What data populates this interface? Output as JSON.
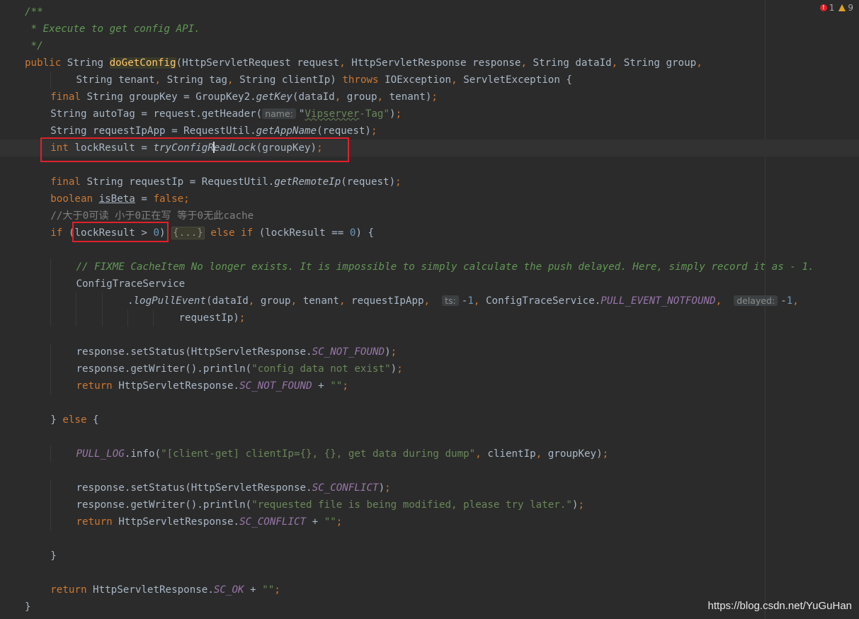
{
  "inspections": {
    "errors": "1",
    "warnings": "9",
    "error_color": "#e0202a",
    "warning_color": "#e0a321"
  },
  "watermark": "https://blog.csdn.net/YuGuHan",
  "colors": {
    "background": "#2b2b2b",
    "keyword": "#cc7832",
    "string": "#6a8759",
    "number": "#6897bb",
    "method_decl": "#ffc66d",
    "constant": "#9876aa",
    "comment": "#808080",
    "doc": "#629755",
    "highlight_box": "#e0202a"
  },
  "lines": [
    {
      "tokens": [
        {
          "t": "/**",
          "c": "doc"
        }
      ]
    },
    {
      "tokens": [
        {
          "t": " * Execute to get config API.",
          "c": "doc"
        }
      ]
    },
    {
      "tokens": [
        {
          "t": " */",
          "c": "doc"
        }
      ]
    },
    {
      "tokens": [
        {
          "t": "public ",
          "c": "kw"
        },
        {
          "t": "String "
        },
        {
          "t": "doGetConfig",
          "c": "fn"
        },
        {
          "t": "(HttpServletRequest request"
        },
        {
          "t": ", ",
          "c": "kw"
        },
        {
          "t": "HttpServletResponse response"
        },
        {
          "t": ", ",
          "c": "kw"
        },
        {
          "t": "String dataId"
        },
        {
          "t": ", ",
          "c": "kw"
        },
        {
          "t": "String group"
        },
        {
          "t": ",",
          "c": "kw"
        }
      ]
    },
    {
      "indent": 8,
      "tokens": [
        {
          "t": "String tenant"
        },
        {
          "t": ", ",
          "c": "kw"
        },
        {
          "t": "String tag"
        },
        {
          "t": ", ",
          "c": "kw"
        },
        {
          "t": "String clientIp) "
        },
        {
          "t": "throws ",
          "c": "kw"
        },
        {
          "t": "IOException"
        },
        {
          "t": ", ",
          "c": "kw"
        },
        {
          "t": "ServletException {"
        }
      ]
    },
    {
      "indent": 4,
      "tokens": [
        {
          "t": "final ",
          "c": "kw"
        },
        {
          "t": "String groupKey = GroupKey2."
        },
        {
          "t": "getKey",
          "c": "static"
        },
        {
          "t": "(dataId"
        },
        {
          "t": ", ",
          "c": "kw"
        },
        {
          "t": "group"
        },
        {
          "t": ", ",
          "c": "kw"
        },
        {
          "t": "tenant)"
        },
        {
          "t": ";",
          "c": "kw"
        }
      ]
    },
    {
      "indent": 4,
      "tokens": [
        {
          "t": "String autoTag = request.getHeader("
        },
        {
          "t": "name:",
          "c": "hint"
        },
        {
          "t": "\""
        },
        {
          "t": "Vipserver",
          "c": "squig"
        },
        {
          "t": "-Tag\"",
          "c": "str"
        },
        {
          "t": ")"
        },
        {
          "t": ";",
          "c": "kw"
        }
      ]
    },
    {
      "indent": 4,
      "tokens": [
        {
          "t": "String requestIpApp = RequestUtil."
        },
        {
          "t": "getAppName",
          "c": "static"
        },
        {
          "t": "(request)"
        },
        {
          "t": ";",
          "c": "kw"
        }
      ]
    },
    {
      "indent": 4,
      "current": true,
      "tokens": [
        {
          "t": "int ",
          "c": "kw"
        },
        {
          "t": "lockResult = "
        },
        {
          "t": "tryConfigR",
          "c": "static"
        },
        {
          "t": "",
          "c": "caret"
        },
        {
          "t": "eadLock",
          "c": "static"
        },
        {
          "t": "(groupKey)"
        },
        {
          "t": ";",
          "c": "kw"
        }
      ]
    },
    {
      "tokens": []
    },
    {
      "indent": 4,
      "tokens": [
        {
          "t": "final ",
          "c": "kw"
        },
        {
          "t": "String requestIp = RequestUtil."
        },
        {
          "t": "getRemoteIp",
          "c": "static"
        },
        {
          "t": "(request)"
        },
        {
          "t": ";",
          "c": "kw"
        }
      ]
    },
    {
      "indent": 4,
      "tokens": [
        {
          "t": "boolean ",
          "c": "kw"
        },
        {
          "t": "isBeta",
          "c": "under"
        },
        {
          "t": " = "
        },
        {
          "t": "false",
          "c": "kw"
        },
        {
          "t": ";",
          "c": "kw"
        }
      ]
    },
    {
      "indent": 4,
      "tokens": [
        {
          "t": "//大于0可读 小于0正在写 等于0无此cache",
          "c": "cmt"
        }
      ]
    },
    {
      "indent": 4,
      "tokens": [
        {
          "t": "if ",
          "c": "kw"
        },
        {
          "t": "(lockResult > "
        },
        {
          "t": "0",
          "c": "num"
        },
        {
          "t": ") "
        },
        {
          "t": "{...}",
          "c": "fold"
        },
        {
          "t": " else if ",
          "c": "kw"
        },
        {
          "t": "(lockResult == "
        },
        {
          "t": "0",
          "c": "num"
        },
        {
          "t": ") {"
        }
      ]
    },
    {
      "tokens": []
    },
    {
      "indent": 8,
      "tokens": [
        {
          "t": "// FIXME CacheItem No longer exists. It is impossible to simply calculate the push delayed. Here, simply record it as - 1.",
          "c": "todo"
        }
      ]
    },
    {
      "indent": 8,
      "tokens": [
        {
          "t": "ConfigTraceService"
        }
      ]
    },
    {
      "indent": 16,
      "tokens": [
        {
          "t": "."
        },
        {
          "t": "logPullEvent",
          "c": "static"
        },
        {
          "t": "(dataId"
        },
        {
          "t": ", ",
          "c": "kw"
        },
        {
          "t": "group"
        },
        {
          "t": ", ",
          "c": "kw"
        },
        {
          "t": "tenant"
        },
        {
          "t": ", ",
          "c": "kw"
        },
        {
          "t": "requestIpApp"
        },
        {
          "t": ",  ",
          "c": "kw"
        },
        {
          "t": "ts:",
          "c": "hint"
        },
        {
          "t": "-"
        },
        {
          "t": "1",
          "c": "num"
        },
        {
          "t": ", ",
          "c": "kw"
        },
        {
          "t": "ConfigTraceService."
        },
        {
          "t": "PULL_EVENT_NOTFOUND",
          "c": "const"
        },
        {
          "t": ",  ",
          "c": "kw"
        },
        {
          "t": "delayed:",
          "c": "hint"
        },
        {
          "t": "-"
        },
        {
          "t": "1",
          "c": "num"
        },
        {
          "t": ",",
          "c": "kw"
        }
      ]
    },
    {
      "indent": 24,
      "tokens": [
        {
          "t": "requestIp)"
        },
        {
          "t": ";",
          "c": "kw"
        }
      ]
    },
    {
      "tokens": []
    },
    {
      "indent": 8,
      "tokens": [
        {
          "t": "response.setStatus(HttpServletResponse."
        },
        {
          "t": "SC_NOT_FOUND",
          "c": "const"
        },
        {
          "t": ")"
        },
        {
          "t": ";",
          "c": "kw"
        }
      ]
    },
    {
      "indent": 8,
      "tokens": [
        {
          "t": "response.getWriter().println("
        },
        {
          "t": "\"config data not exist\"",
          "c": "str"
        },
        {
          "t": ")"
        },
        {
          "t": ";",
          "c": "kw"
        }
      ]
    },
    {
      "indent": 8,
      "tokens": [
        {
          "t": "return ",
          "c": "kw"
        },
        {
          "t": "HttpServletResponse."
        },
        {
          "t": "SC_NOT_FOUND",
          "c": "const"
        },
        {
          "t": " + "
        },
        {
          "t": "\"\"",
          "c": "str"
        },
        {
          "t": ";",
          "c": "kw"
        }
      ]
    },
    {
      "tokens": []
    },
    {
      "indent": 4,
      "tokens": [
        {
          "t": "} "
        },
        {
          "t": "else ",
          "c": "kw"
        },
        {
          "t": "{"
        }
      ]
    },
    {
      "tokens": []
    },
    {
      "indent": 8,
      "tokens": [
        {
          "t": "PULL_LOG",
          "c": "const"
        },
        {
          "t": ".info("
        },
        {
          "t": "\"[client-get] clientIp={}, {}, get data during dump\"",
          "c": "str"
        },
        {
          "t": ", ",
          "c": "kw"
        },
        {
          "t": "clientIp"
        },
        {
          "t": ", ",
          "c": "kw"
        },
        {
          "t": "groupKey)"
        },
        {
          "t": ";",
          "c": "kw"
        }
      ]
    },
    {
      "tokens": []
    },
    {
      "indent": 8,
      "tokens": [
        {
          "t": "response.setStatus(HttpServletResponse."
        },
        {
          "t": "SC_CONFLICT",
          "c": "const"
        },
        {
          "t": ")"
        },
        {
          "t": ";",
          "c": "kw"
        }
      ]
    },
    {
      "indent": 8,
      "tokens": [
        {
          "t": "response.getWriter().println("
        },
        {
          "t": "\"requested file is being modified, please try later.\"",
          "c": "str"
        },
        {
          "t": ")"
        },
        {
          "t": ";",
          "c": "kw"
        }
      ]
    },
    {
      "indent": 8,
      "tokens": [
        {
          "t": "return ",
          "c": "kw"
        },
        {
          "t": "HttpServletResponse."
        },
        {
          "t": "SC_CONFLICT",
          "c": "const"
        },
        {
          "t": " + "
        },
        {
          "t": "\"\"",
          "c": "str"
        },
        {
          "t": ";",
          "c": "kw"
        }
      ]
    },
    {
      "tokens": []
    },
    {
      "indent": 4,
      "tokens": [
        {
          "t": "}"
        }
      ]
    },
    {
      "tokens": []
    },
    {
      "indent": 4,
      "tokens": [
        {
          "t": "return ",
          "c": "kw"
        },
        {
          "t": "HttpServletResponse."
        },
        {
          "t": "SC_OK",
          "c": "const"
        },
        {
          "t": " + "
        },
        {
          "t": "\"\"",
          "c": "str"
        },
        {
          "t": ";",
          "c": "kw"
        }
      ]
    },
    {
      "tokens": [
        {
          "t": "}"
        }
      ]
    }
  ]
}
